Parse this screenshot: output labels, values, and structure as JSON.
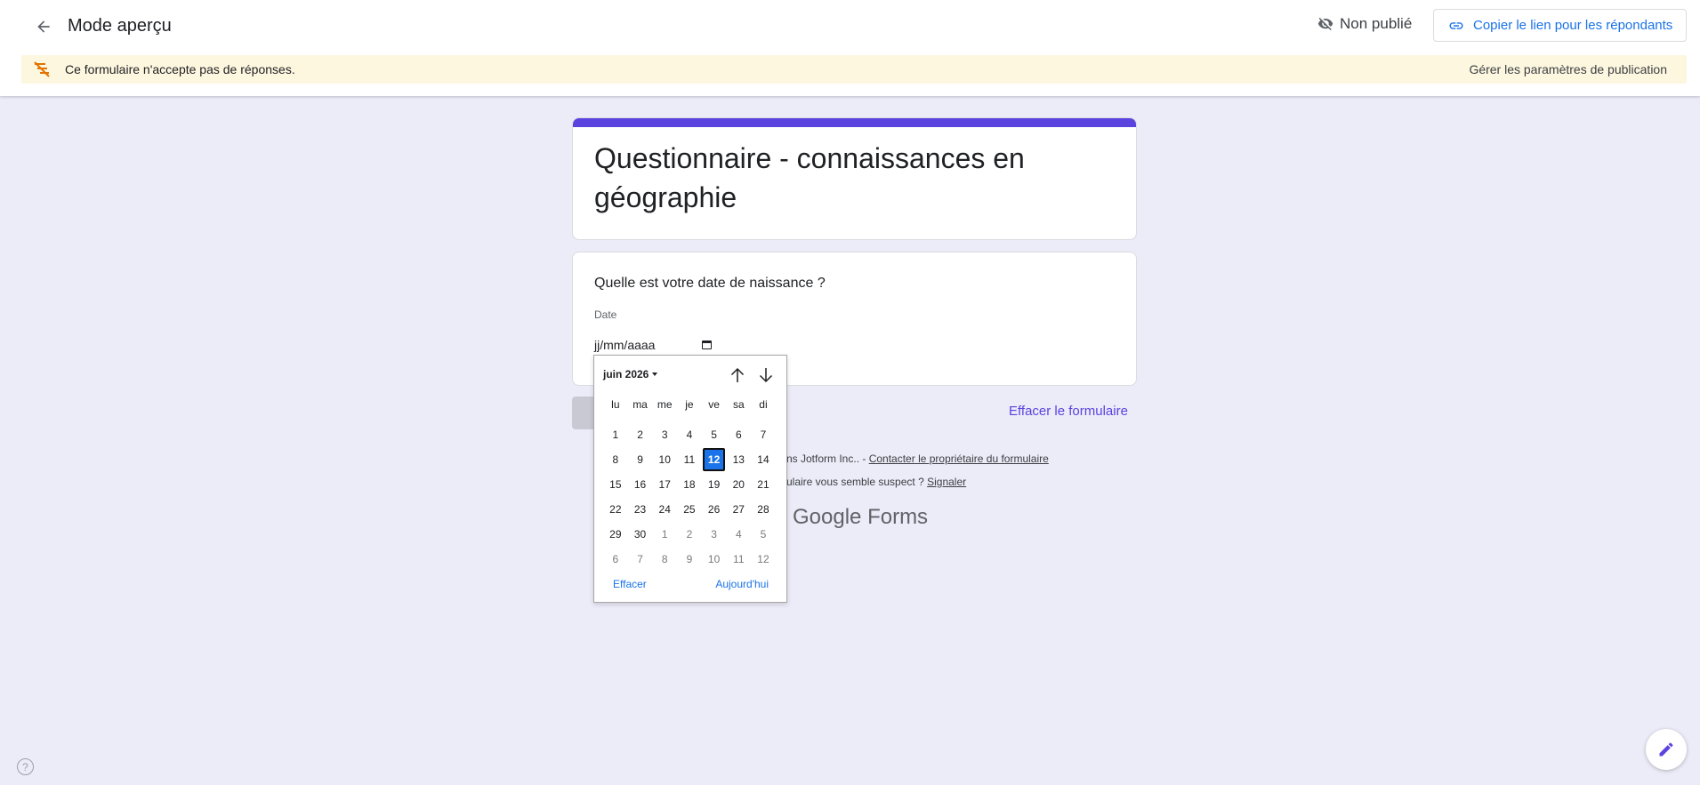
{
  "header": {
    "title": "Mode aperçu",
    "status": "Non publié",
    "copy_link_label": "Copier le lien pour les répondants"
  },
  "banner": {
    "message": "Ce formulaire n'accepte pas de réponses.",
    "link": "Gérer les paramètres de publication"
  },
  "form": {
    "title": "Questionnaire - connaissances en géographie",
    "accent_color": "#5b43e0",
    "question": {
      "title": "Quelle est votre date de naissance ?",
      "sublabel": "Date",
      "date_value": "jj/mm/aaaa"
    },
    "clear_form": "Effacer le formulaire"
  },
  "footer": {
    "line1_text": "ns Jotform Inc.. - ",
    "line1_link": "Contacter le propriétaire du formulaire",
    "line2_text": "ulaire vous semble suspect ? ",
    "line2_link": "Signaler",
    "brand_google": "Google",
    "brand_forms": "Forms"
  },
  "datepicker": {
    "month_label": "juin 2026",
    "weekdays": [
      "lu",
      "ma",
      "me",
      "je",
      "ve",
      "sa",
      "di"
    ],
    "days": [
      {
        "d": "1",
        "cur": true
      },
      {
        "d": "2",
        "cur": true
      },
      {
        "d": "3",
        "cur": true
      },
      {
        "d": "4",
        "cur": true
      },
      {
        "d": "5",
        "cur": true
      },
      {
        "d": "6",
        "cur": true
      },
      {
        "d": "7",
        "cur": true
      },
      {
        "d": "8",
        "cur": true
      },
      {
        "d": "9",
        "cur": true
      },
      {
        "d": "10",
        "cur": true
      },
      {
        "d": "11",
        "cur": true
      },
      {
        "d": "12",
        "cur": true,
        "selected": true
      },
      {
        "d": "13",
        "cur": true
      },
      {
        "d": "14",
        "cur": true
      },
      {
        "d": "15",
        "cur": true
      },
      {
        "d": "16",
        "cur": true
      },
      {
        "d": "17",
        "cur": true
      },
      {
        "d": "18",
        "cur": true
      },
      {
        "d": "19",
        "cur": true
      },
      {
        "d": "20",
        "cur": true
      },
      {
        "d": "21",
        "cur": true
      },
      {
        "d": "22",
        "cur": true
      },
      {
        "d": "23",
        "cur": true
      },
      {
        "d": "24",
        "cur": true
      },
      {
        "d": "25",
        "cur": true
      },
      {
        "d": "26",
        "cur": true
      },
      {
        "d": "27",
        "cur": true
      },
      {
        "d": "28",
        "cur": true
      },
      {
        "d": "29",
        "cur": true
      },
      {
        "d": "30",
        "cur": true
      },
      {
        "d": "1",
        "cur": false
      },
      {
        "d": "2",
        "cur": false
      },
      {
        "d": "3",
        "cur": false
      },
      {
        "d": "4",
        "cur": false
      },
      {
        "d": "5",
        "cur": false
      },
      {
        "d": "6",
        "cur": false
      },
      {
        "d": "7",
        "cur": false
      },
      {
        "d": "8",
        "cur": false
      },
      {
        "d": "9",
        "cur": false
      },
      {
        "d": "10",
        "cur": false
      },
      {
        "d": "11",
        "cur": false
      },
      {
        "d": "12",
        "cur": false
      }
    ],
    "clear_label": "Effacer",
    "today_label": "Aujourd'hui"
  },
  "icons": {
    "back": "arrow-back-icon",
    "status": "visibility-off-icon",
    "copy": "link-icon",
    "banner": "no-responses-icon",
    "help": "help-icon",
    "edit": "pencil-icon"
  },
  "help_label": "?"
}
